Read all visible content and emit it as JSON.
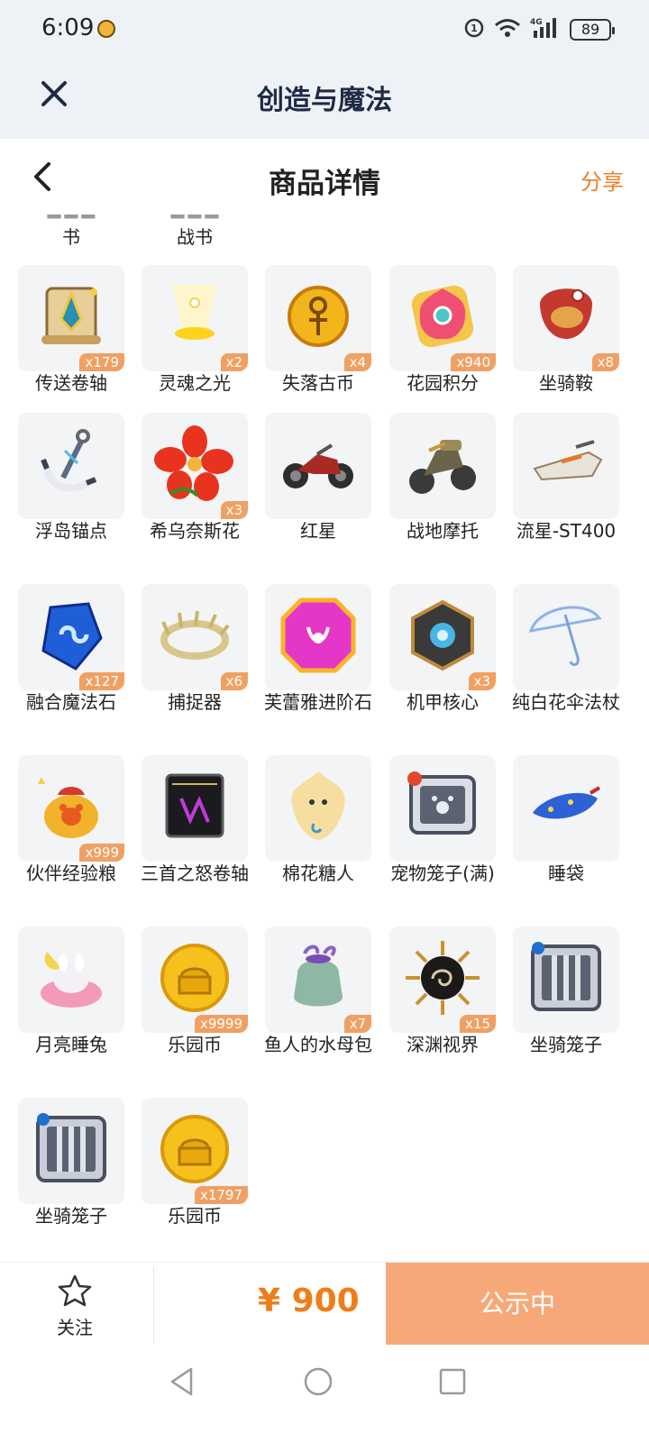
{
  "status_bar": {
    "time": "6:09",
    "battery": "89",
    "network": "4G"
  },
  "app_header": {
    "title": "创造与魔法"
  },
  "page_nav": {
    "title": "商品详情",
    "share_label": "分享"
  },
  "partial_row": [
    "书",
    "战书"
  ],
  "items": [
    {
      "name": "传送卷轴",
      "qty": "x179",
      "icon": "scroll-icon"
    },
    {
      "name": "灵魂之光",
      "qty": "x2",
      "icon": "soul-light-icon"
    },
    {
      "name": "失落古币",
      "qty": "x4",
      "icon": "ancient-coin-icon"
    },
    {
      "name": "花园积分",
      "qty": "x940",
      "icon": "flower-badge-icon"
    },
    {
      "name": "坐骑鞍",
      "qty": "x8",
      "icon": "saddle-icon"
    },
    {
      "name": "浮岛锚点",
      "qty": "",
      "icon": "anchor-icon"
    },
    {
      "name": "希乌奈斯花",
      "qty": "x3",
      "icon": "red-flower-icon"
    },
    {
      "name": "红星",
      "qty": "",
      "icon": "motorcycle-icon"
    },
    {
      "name": "战地摩托",
      "qty": "",
      "icon": "war-motorcycle-icon"
    },
    {
      "name": "流星-ST400",
      "qty": "",
      "icon": "hoverbike-icon"
    },
    {
      "name": "融合魔法石",
      "qty": "x127",
      "icon": "blue-crystal-icon"
    },
    {
      "name": "捕捉器",
      "qty": "x6",
      "icon": "trap-ring-icon"
    },
    {
      "name": "芙蕾雅进阶石",
      "qty": "",
      "icon": "gem-icon"
    },
    {
      "name": "机甲核心",
      "qty": "x3",
      "icon": "mech-core-icon"
    },
    {
      "name": "纯白花伞法杖",
      "qty": "",
      "icon": "umbrella-icon"
    },
    {
      "name": "伙伴经验粮",
      "qty": "x999",
      "icon": "food-bag-icon"
    },
    {
      "name": "三首之怒卷轴",
      "qty": "",
      "icon": "dark-scroll-icon"
    },
    {
      "name": "棉花糖人",
      "qty": "",
      "icon": "cotton-creature-icon"
    },
    {
      "name": "宠物笼子(满)",
      "qty": "",
      "icon": "pet-cage-icon"
    },
    {
      "name": "睡袋",
      "qty": "",
      "icon": "sleeping-bag-icon"
    },
    {
      "name": "月亮睡兔",
      "qty": "",
      "icon": "moon-rabbit-icon"
    },
    {
      "name": "乐园币",
      "qty": "x9999",
      "icon": "gold-coin-icon"
    },
    {
      "name": "鱼人的水母包",
      "qty": "x7",
      "icon": "jellyfish-bag-icon"
    },
    {
      "name": "深渊视界",
      "qty": "x15",
      "icon": "abyss-sun-icon"
    },
    {
      "name": "坐骑笼子",
      "qty": "",
      "icon": "mount-cage-icon"
    },
    {
      "name": "坐骑笼子",
      "qty": "",
      "icon": "mount-cage-icon"
    },
    {
      "name": "乐园币",
      "qty": "x1797",
      "icon": "gold-coin-icon"
    }
  ],
  "action_bar": {
    "follow_label": "关注",
    "price": "¥ 900",
    "status_label": "公示中"
  },
  "colors": {
    "accent": "#ef7d18",
    "share": "#e9822a",
    "badge": "#f0a062",
    "status_button": "#f7a878"
  }
}
